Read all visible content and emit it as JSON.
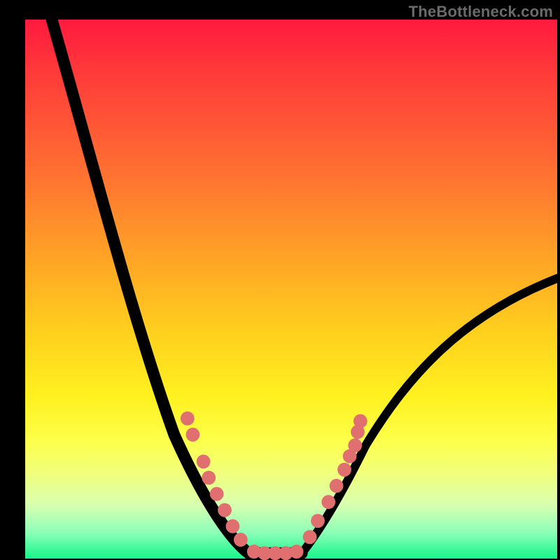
{
  "watermark": "TheBottleneck.com",
  "chart_data": {
    "type": "line",
    "title": "",
    "xlabel": "",
    "ylabel": "",
    "xlim": [
      0,
      100
    ],
    "ylim": [
      0,
      100
    ],
    "background_gradient": {
      "direction": "vertical",
      "stops": [
        {
          "pos": 0.0,
          "color": "#ff1a3f"
        },
        {
          "pos": 0.28,
          "color": "#ff6f32"
        },
        {
          "pos": 0.58,
          "color": "#ffd01e"
        },
        {
          "pos": 0.78,
          "color": "#fdff4a"
        },
        {
          "pos": 0.95,
          "color": "#8fffb8"
        },
        {
          "pos": 1.0,
          "color": "#16f58b"
        }
      ]
    },
    "series": [
      {
        "name": "bottleneck-curve",
        "color": "#000000",
        "x": [
          5,
          12,
          20,
          28,
          33,
          38,
          42,
          47,
          52,
          56,
          60,
          64,
          72,
          82,
          100
        ],
        "y": [
          100,
          76,
          45,
          23,
          12,
          4,
          1,
          1,
          1,
          6,
          13,
          21,
          34,
          45,
          52
        ],
        "note": "y is bottleneck percent (0=optimal at bottom, 100=worst at top); values estimated from image"
      },
      {
        "name": "marker-points",
        "type": "scatter",
        "color": "#e07070",
        "x": [
          30.5,
          31.5,
          33.5,
          34.5,
          36,
          37.5,
          39,
          40.5,
          43,
          45,
          47,
          49,
          51,
          53.5,
          55,
          57,
          58.5,
          60,
          61,
          62,
          62.5,
          63
        ],
        "y": [
          26,
          23,
          18,
          15,
          12,
          9,
          6,
          3.5,
          1.3,
          1,
          1,
          1,
          1.3,
          4,
          7,
          10.5,
          13.5,
          16.5,
          19,
          21,
          23.5,
          25.5
        ]
      }
    ]
  }
}
